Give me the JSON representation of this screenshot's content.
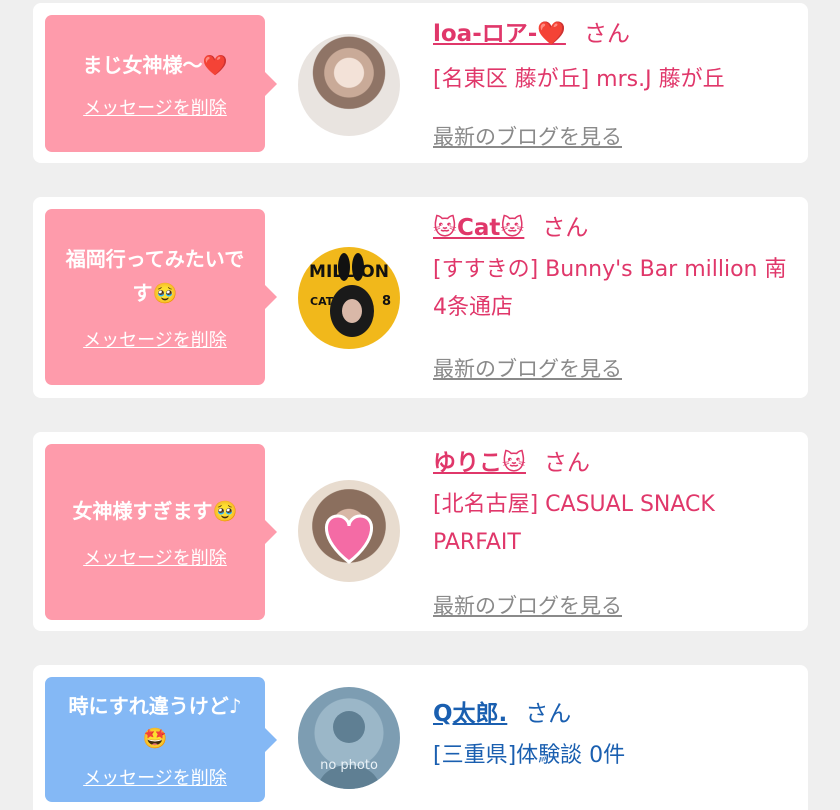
{
  "cards": [
    {
      "message": "まじ女神様〜❤️",
      "delete_label": "メッセージを削除",
      "name": "loa-ロア-❤️",
      "honorific": "さん",
      "shop": "[名東区 藤が丘] mrs.J 藤が丘",
      "blog_link": "最新のブログを見る",
      "theme": "pink"
    },
    {
      "message": "福岡行ってみたいです🥹",
      "delete_label": "メッセージを削除",
      "name": "🐱Cat🐱",
      "honorific": "さん",
      "shop": "[すすきの] Bunny's Bar million 南4条通店",
      "blog_link": "最新のブログを見る",
      "theme": "pink"
    },
    {
      "message": "女神様すぎます🥹",
      "delete_label": "メッセージを削除",
      "name": "ゆりこ🐱",
      "honorific": "さん",
      "shop": "[北名古屋] CASUAL SNACK PARFAIT",
      "blog_link": "最新のブログを見る",
      "theme": "pink"
    },
    {
      "message": "時にすれ違うけど♪🤩",
      "delete_label": "メッセージを削除",
      "name": "Q太郎.",
      "honorific": "さん",
      "shop": "[三重県]体験談 0件",
      "avatar_text": "no photo",
      "theme": "blue"
    }
  ],
  "avatar_labels": {
    "cat_poster_top": "MILLION",
    "cat_poster_name": "CAT",
    "cat_poster_num": "8"
  },
  "colors": {
    "page_bg": "#efefef",
    "pink_bubble": "#fe9bab",
    "blue_bubble": "#84b8f5",
    "pink_text": "#e0376a",
    "blue_text": "#1a5fb0"
  }
}
